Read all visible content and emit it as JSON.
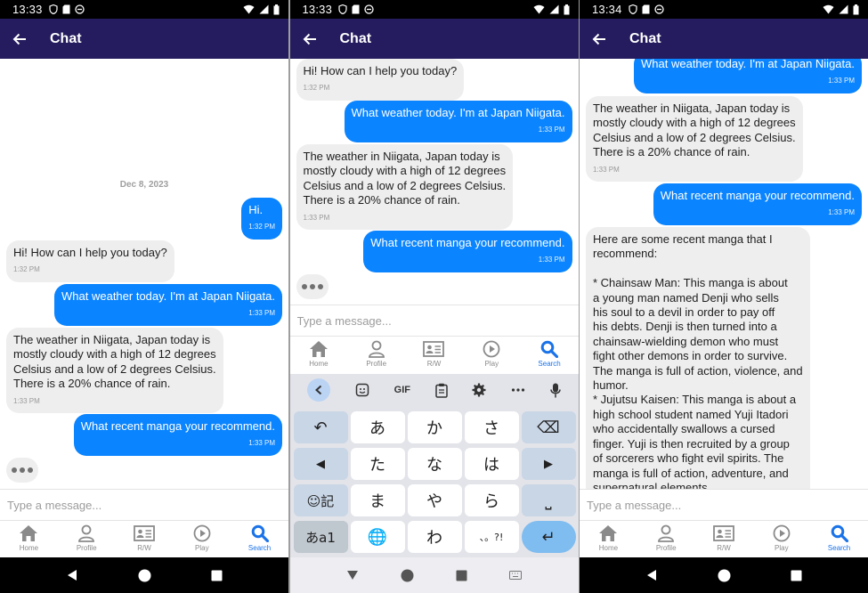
{
  "status_bar": {
    "times": [
      "13:33",
      "13:33",
      "13:34"
    ]
  },
  "app_bar": {
    "title": "Chat"
  },
  "chat": {
    "date": "Dec 8, 2023",
    "messages": {
      "user_hi": {
        "text": "Hi.",
        "time": "1:32 PM"
      },
      "bot_greeting": {
        "text": "Hi! How can I help you today?",
        "time": "1:32 PM"
      },
      "user_weather": {
        "text": "What weather today. I'm at Japan Niigata.",
        "time": "1:33 PM"
      },
      "bot_weather": {
        "text": "The weather in Niigata, Japan today is\nmostly cloudy with a high of 12 degrees\nCelsius and a low of 2 degrees Celsius.\nThere is a 20% chance of rain.",
        "time": "1:33 PM"
      },
      "user_manga": {
        "text": "What recent manga your recommend.",
        "time": "1:33 PM"
      },
      "bot_manga": {
        "text": "Here are some recent manga that I\nrecommend:\n\n* Chainsaw Man: This manga is about\na young man named Denji who sells\nhis soul to a devil in order to pay off\nhis debts. Denji is then turned into a\nchainsaw-wielding demon who must\nfight other demons in order to survive.\nThe manga is full of action, violence, and\nhumor.\n* Jujutsu Kaisen: This manga is about a\nhigh school student named Yuji Itadori\nwho accidentally swallows a cursed\nfinger. Yuji is then recruited by a group\nof sorcerers who fight evil spirits. The\nmanga is full of action, adventure, and\nsupernatural elements."
      }
    }
  },
  "composer": {
    "placeholder": "Type a message..."
  },
  "tabs": [
    "Home",
    "Profile",
    "R/W",
    "Play",
    "Search"
  ],
  "keyboard": {
    "gif_label": "GIF",
    "keys": {
      "undo": "↶",
      "a": "あ",
      "ka": "か",
      "sa": "さ",
      "backspace": "⌫",
      "left": "◀",
      "ta": "た",
      "na": "な",
      "ha": "は",
      "right": "▶",
      "emoji": "☺記",
      "ma": "ま",
      "ya": "や",
      "ra": "ら",
      "space": "⎵",
      "kana_switch": "あa1",
      "globe": "🌐",
      "wa": "わ",
      "punct": "、。?!",
      "enter": "↵"
    }
  },
  "colors": {
    "app_bar": "#241c5e",
    "user_bubble": "#0a84ff",
    "bot_bubble": "#eeeeee",
    "active_tab": "#1a73e8"
  }
}
